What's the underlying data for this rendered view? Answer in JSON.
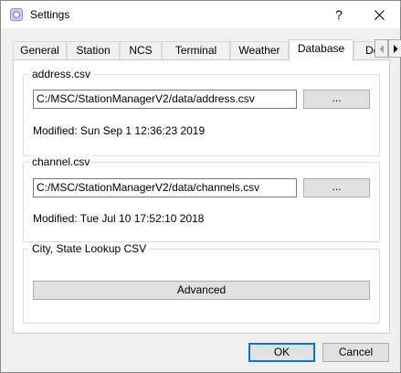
{
  "window": {
    "title": "Settings",
    "help_label": "?",
    "app_icon": "settings-app-icon",
    "close_icon": "close-icon"
  },
  "tabs": [
    {
      "label": "General"
    },
    {
      "label": "Station"
    },
    {
      "label": "NCS"
    },
    {
      "label": "Terminal"
    },
    {
      "label": "Weather"
    },
    {
      "label": "Database",
      "active": true
    },
    {
      "label": "Device"
    }
  ],
  "tab_scroll": {
    "left_icon": "chevron-left-icon",
    "right_icon": "chevron-right-icon"
  },
  "groups": {
    "address": {
      "title": "address.csv",
      "path": "C:/MSC/StationManagerV2/data/address.csv",
      "browse_label": "...",
      "modified": "Modified: Sun Sep 1 12:36:23 2019"
    },
    "channel": {
      "title": "channel.csv",
      "path": "C:/MSC/StationManagerV2/data/channels.csv",
      "browse_label": "...",
      "modified": "Modified: Tue Jul 10 17:52:10 2018"
    },
    "city_state": {
      "title": "City, State Lookup CSV",
      "advanced_label": "Advanced"
    }
  },
  "buttons": {
    "ok": "OK",
    "cancel": "Cancel"
  },
  "colors": {
    "default_button_border": "#0078d7",
    "page_background": "#f0f0f0",
    "tab_page_background": "#ffffff"
  }
}
